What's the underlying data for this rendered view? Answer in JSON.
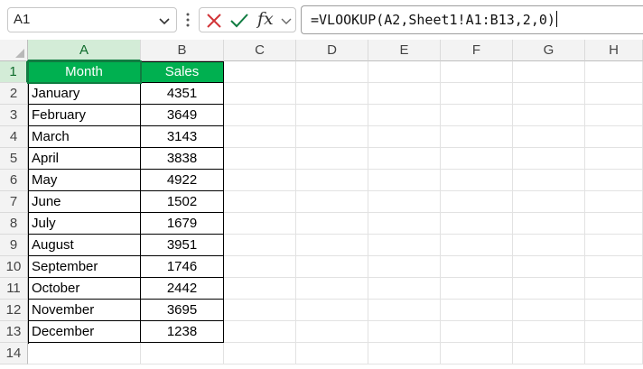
{
  "name_box": {
    "value": "A1"
  },
  "formula_bar": {
    "cancel_icon": "x-icon",
    "enter_icon": "check-icon",
    "fx_label": "fx",
    "formula": "=VLOOKUP(A2,Sheet1!A1:B13,2,0)"
  },
  "columns": [
    "A",
    "B",
    "C",
    "D",
    "E",
    "F",
    "G",
    "H"
  ],
  "rows": [
    "1",
    "2",
    "3",
    "4",
    "5",
    "6",
    "7",
    "8",
    "9",
    "10",
    "11",
    "12",
    "13",
    "14"
  ],
  "table": {
    "headers": {
      "month": "Month",
      "sales": "Sales"
    },
    "rows": [
      {
        "month": "January",
        "sales": "4351"
      },
      {
        "month": "February",
        "sales": "3649"
      },
      {
        "month": "March",
        "sales": "3143"
      },
      {
        "month": "April",
        "sales": "3838"
      },
      {
        "month": "May",
        "sales": "4922"
      },
      {
        "month": "June",
        "sales": "1502"
      },
      {
        "month": "July",
        "sales": "1679"
      },
      {
        "month": "August",
        "sales": "3951"
      },
      {
        "month": "September",
        "sales": "1746"
      },
      {
        "month": "October",
        "sales": "2442"
      },
      {
        "month": "November",
        "sales": "3695"
      },
      {
        "month": "December",
        "sales": "1238"
      }
    ]
  },
  "colors": {
    "header_fill": "#00b050",
    "selection": "#107c41",
    "cancel": "#d13438",
    "enter": "#107c41"
  }
}
